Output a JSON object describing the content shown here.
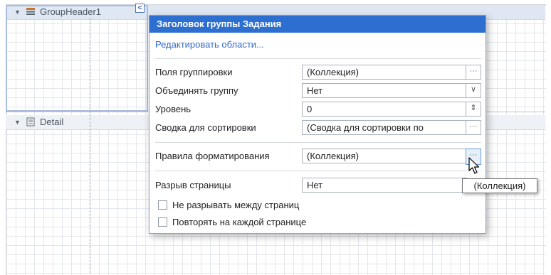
{
  "bands": {
    "group_header": {
      "label": "GroupHeader1"
    },
    "detail": {
      "label": "Detail"
    }
  },
  "panel": {
    "title": "Заголовок группы Задания",
    "edit_link": "Редактировать области...",
    "fields": [
      {
        "label": "Поля группировки",
        "value": "(Коллекция)",
        "button": "···"
      },
      {
        "label": "Объединять группу",
        "value": "Нет",
        "button": "∨"
      },
      {
        "label": "Уровень",
        "value": "0",
        "button": "⇕"
      },
      {
        "label": "Сводка для сортировки",
        "value": "(Сводка для сортировки по",
        "button": "···"
      },
      {
        "label": "Правила форматирования",
        "value": "(Коллекция)",
        "button": "···"
      },
      {
        "label": "Разрыв страницы",
        "value": "Нет",
        "button": ""
      }
    ],
    "checkboxes": [
      {
        "label": "Не разрывать между страниц",
        "checked": false
      },
      {
        "label": "Повторять на каждой странице",
        "checked": false
      }
    ]
  },
  "smart_tag": {
    "glyph": "<"
  },
  "tooltip": {
    "text": "(Коллекция)"
  },
  "colors": {
    "title_bar": "#2c6fd0",
    "link": "#2f6ad1",
    "selection": "#aabde0"
  }
}
